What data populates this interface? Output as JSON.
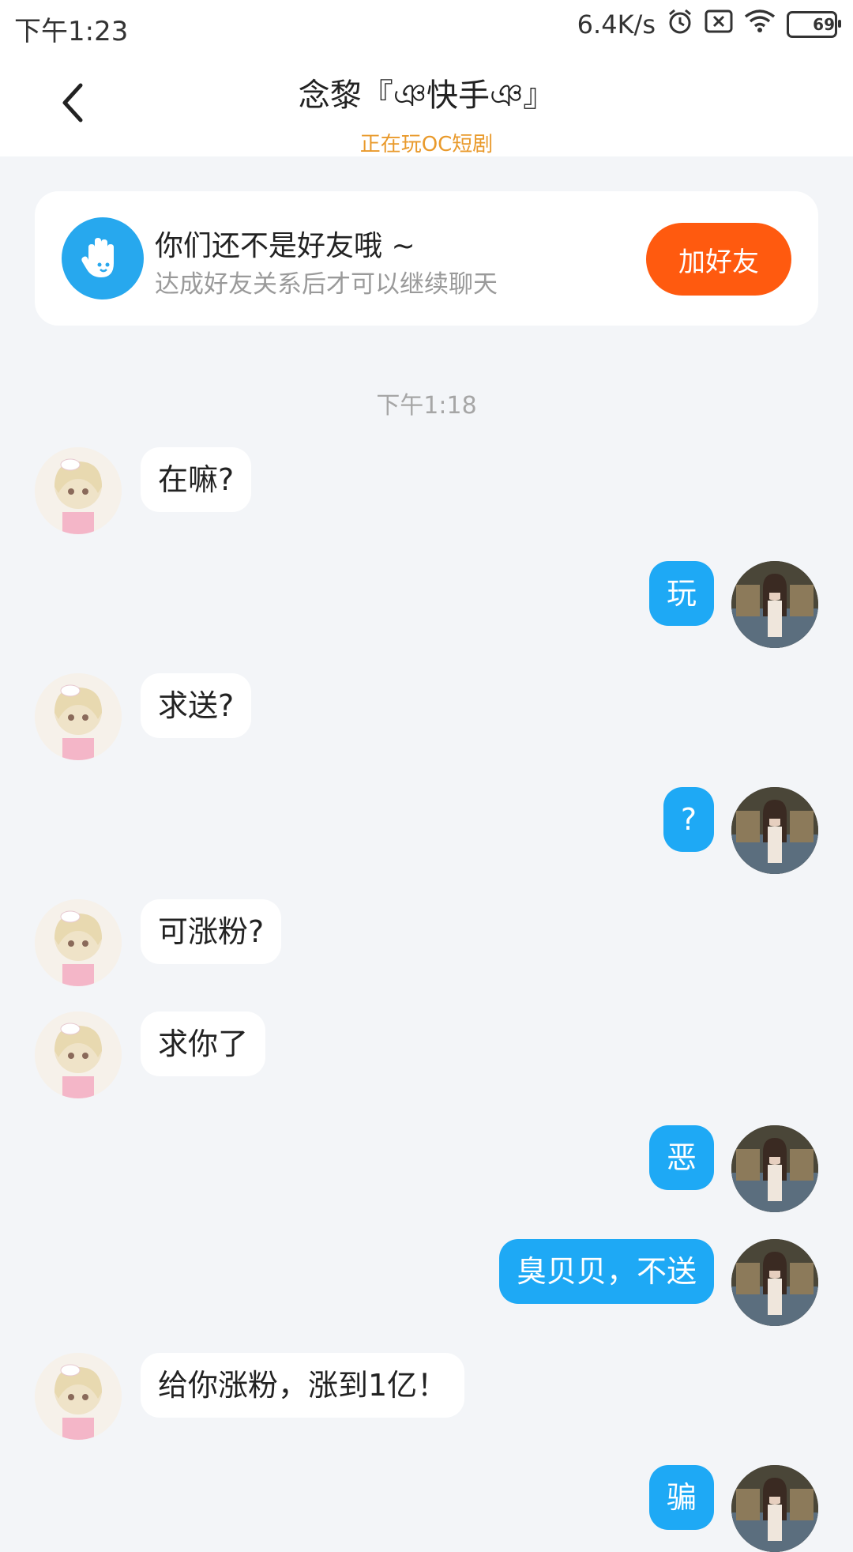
{
  "status_bar": {
    "time": "下午1:23",
    "net_speed": "6.4K/s",
    "battery": "69",
    "battery_fraction": 0.69,
    "icons": [
      "alarm-icon",
      "sim-off-icon",
      "wifi-icon",
      "battery-icon"
    ]
  },
  "header": {
    "title": "念黎『ঞ快手ঞ』",
    "subtitle": "正在玩OC短剧",
    "back_icon": "chevron-left-icon"
  },
  "friend_card": {
    "icon": "waving-hand-icon",
    "title": "你们还不是好友哦 ~",
    "subtitle": "达成好友关系后才可以继续聊天",
    "button_label": "加好友"
  },
  "timestamp": "下午1:18",
  "messages": [
    {
      "side": "left",
      "text": "在嘛?"
    },
    {
      "side": "right",
      "text": "玩"
    },
    {
      "side": "left",
      "text": "求送?"
    },
    {
      "side": "right",
      "text": "?"
    },
    {
      "side": "left",
      "text": "可涨粉?"
    },
    {
      "side": "left",
      "text": "求你了"
    },
    {
      "side": "right",
      "text": "恶"
    },
    {
      "side": "right",
      "text": "臭贝贝，不送"
    },
    {
      "side": "left",
      "text": "给你涨粉，涨到1亿！"
    },
    {
      "side": "right",
      "text": "骗"
    }
  ],
  "colors": {
    "accent_blue": "#1ea9f5",
    "add_friend_orange": "#ff5a0f",
    "subtitle_orange": "#e99a2c",
    "background": "#f3f5f8"
  }
}
